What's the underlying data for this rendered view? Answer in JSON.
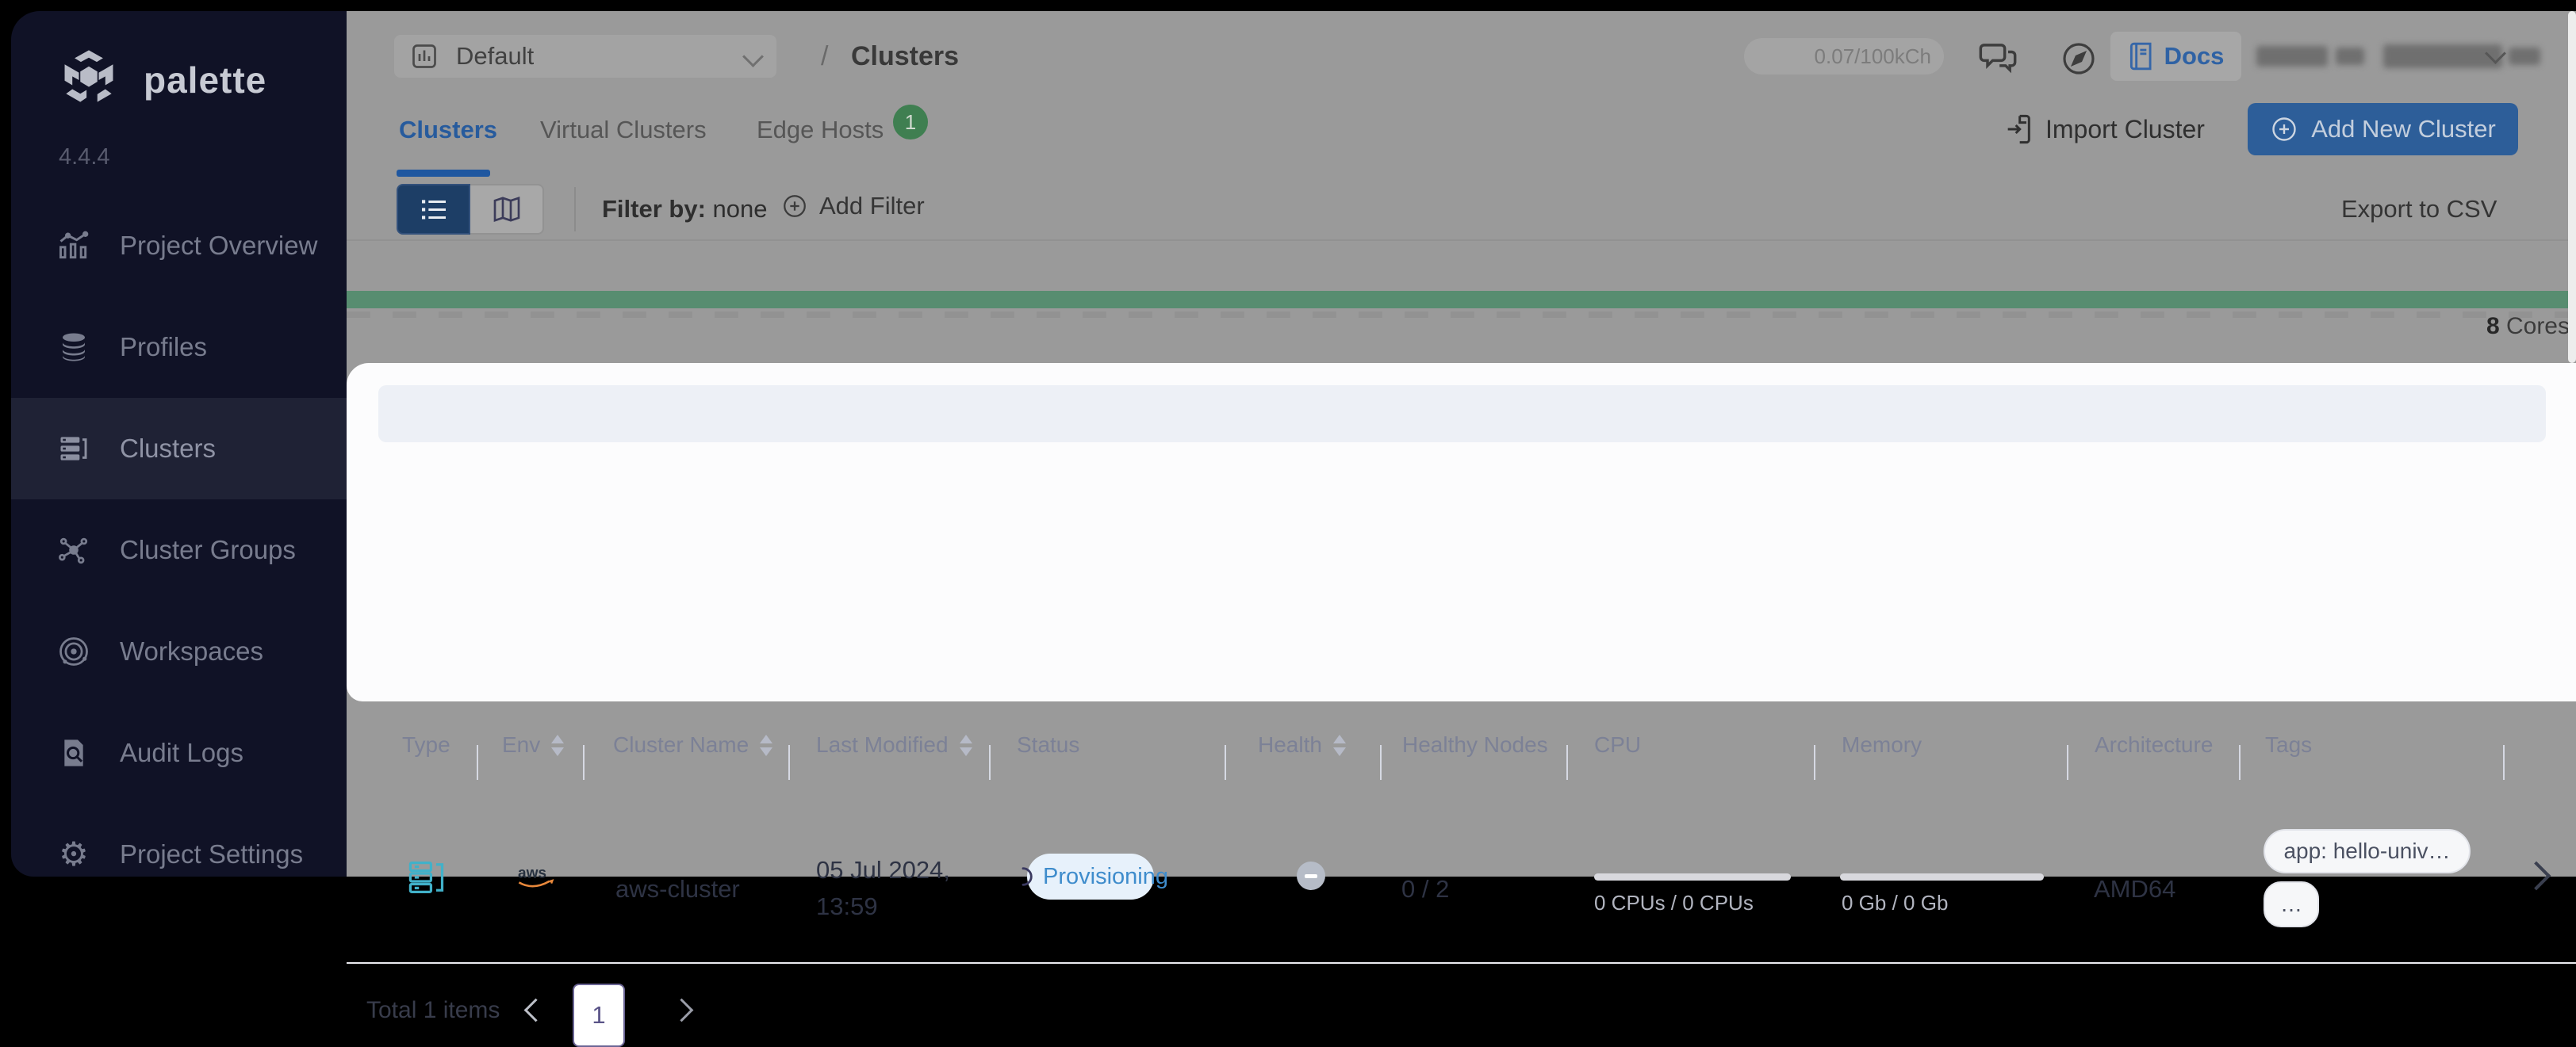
{
  "app": {
    "brand": "palette",
    "version": "4.4.4"
  },
  "sidebar": {
    "items": [
      {
        "label": "Project Overview"
      },
      {
        "label": "Profiles"
      },
      {
        "label": "Clusters"
      },
      {
        "label": "Cluster Groups"
      },
      {
        "label": "Workspaces"
      },
      {
        "label": "Audit Logs"
      },
      {
        "label": "Project Settings"
      }
    ]
  },
  "topbar": {
    "project_selector": "Default",
    "breadcrumb_separator": "/",
    "breadcrumb_current": "Clusters",
    "usage": "0.07/100kCh",
    "docs_label": "Docs"
  },
  "tabs": {
    "items": [
      {
        "label": "Clusters"
      },
      {
        "label": "Virtual Clusters"
      },
      {
        "label": "Edge Hosts",
        "badge": "1"
      }
    ]
  },
  "actions": {
    "import_label": "Import Cluster",
    "add_label": "Add New Cluster",
    "export_label": "Export to CSV"
  },
  "filters": {
    "filter_by_label": "Filter by:",
    "filter_by_value": "none",
    "add_filter_label": "Add Filter"
  },
  "usage_meter": {
    "cores_value": "8",
    "cores_label": "Cores"
  },
  "table": {
    "columns": [
      {
        "label": "Type"
      },
      {
        "label": "Env",
        "sortable": true
      },
      {
        "label": "Cluster Name",
        "sortable": true
      },
      {
        "label": "Last Modified",
        "sortable": true
      },
      {
        "label": "Status"
      },
      {
        "label": "Health",
        "sortable": true
      },
      {
        "label": "Healthy Nodes"
      },
      {
        "label": "CPU"
      },
      {
        "label": "Memory"
      },
      {
        "label": "Architecture"
      },
      {
        "label": "Tags"
      }
    ],
    "row": {
      "env": "aws",
      "name": "aws-cluster",
      "modified_line1": "05 Jul 2024,",
      "modified_line2": "13:59",
      "status": "Provisioning",
      "healthy_nodes": "0 / 2",
      "cpu_usage": "0 CPUs / 0 CPUs",
      "memory_usage": "0 Gb / 0 Gb",
      "architecture": "AMD64",
      "tag_primary": "app: hello-univ…",
      "tag_more": "…"
    }
  },
  "pagination": {
    "total": "Total 1 items",
    "page": "1"
  },
  "colors": {
    "accent_blue": "#2d5e99",
    "tab_blue": "#275b9d",
    "status_blue": "#3e8ccc",
    "green_bar": "#578d70",
    "badge_green": "#3f7f51",
    "sidebar_bg": "#101226",
    "overlay_gray": "#9a9a9a",
    "card_bg": "#fcfcfd"
  }
}
